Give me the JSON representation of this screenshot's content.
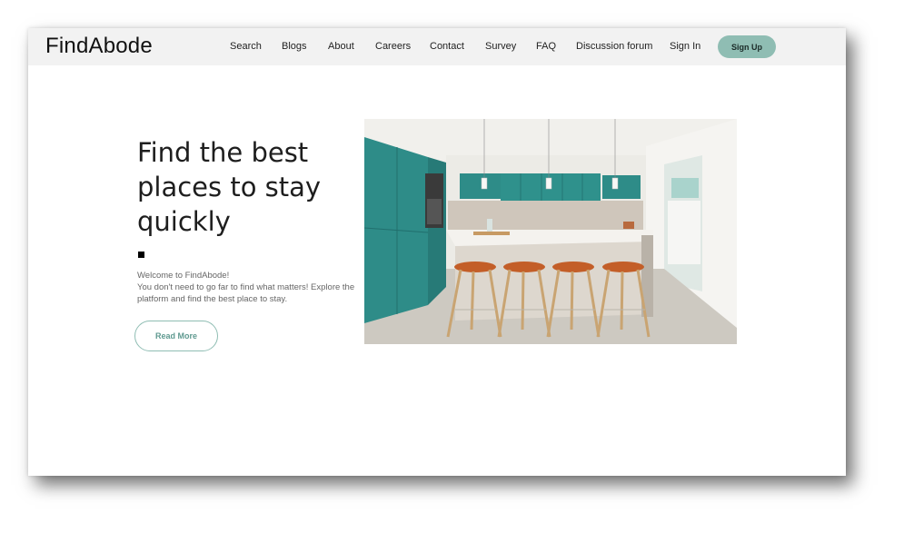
{
  "brand": "FindAbode",
  "nav": {
    "items": [
      "Search",
      "Blogs",
      "About",
      "Careers",
      "Contact",
      "Survey",
      "FAQ",
      "Discussion forum",
      "Sign In"
    ],
    "signup": "Sign Up"
  },
  "hero": {
    "title_lines": [
      "Find the best",
      "places to stay",
      "quickly"
    ],
    "intro_lines": [
      "Welcome to FindAbode!",
      "You don't need to go far to find what matters! Explore the",
      "platform and find the best place to stay."
    ],
    "read_more": "Read More",
    "image_description_icon": "kitchen-photo"
  },
  "colors": {
    "accent": "#8fbdb3",
    "navbar_bg": "#f2f2f2",
    "teal_cabinet": "#2e8c88"
  }
}
